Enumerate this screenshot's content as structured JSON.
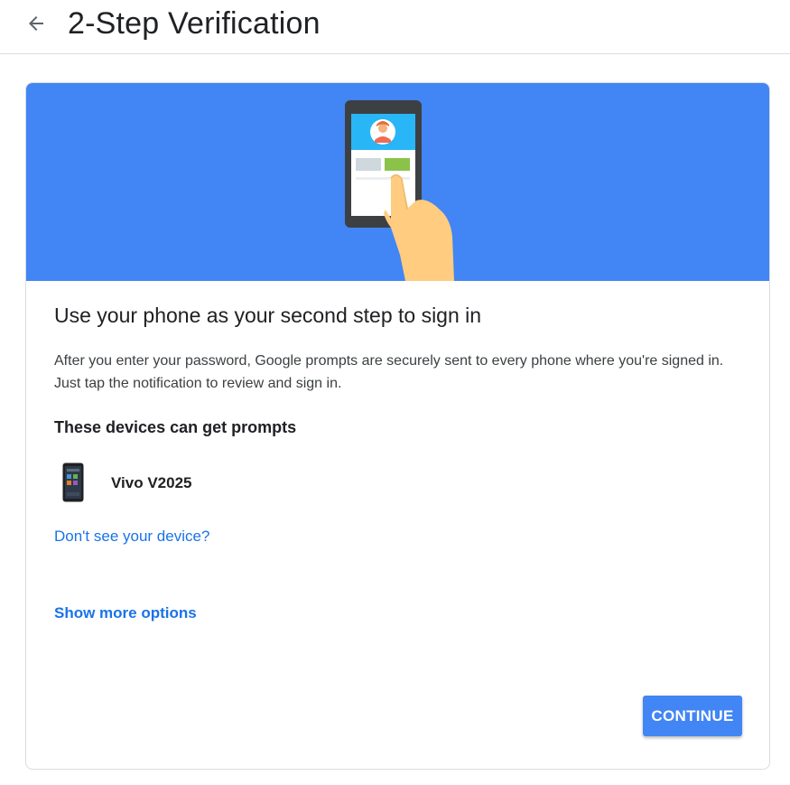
{
  "header": {
    "title": "2-Step Verification",
    "back_icon": "arrow-left-icon"
  },
  "hero": {
    "background_color": "#4285f4",
    "illustration": "phone-tap-prompt-illustration"
  },
  "card": {
    "title": "Use your phone as your second step to sign in",
    "description": "After you enter your password, Google prompts are securely sent to every phone where you're signed in. Just tap the notification to review and sign in.",
    "devices_heading": "These devices can get prompts",
    "devices": [
      {
        "name": "Vivo V2025",
        "icon": "smartphone-icon"
      }
    ],
    "dont_see_device_link": "Don't see your device?",
    "show_more_options_link": "Show more options",
    "continue_label": "CONTINUE"
  },
  "colors": {
    "accent": "#4285f4",
    "link": "#1a73e8"
  }
}
